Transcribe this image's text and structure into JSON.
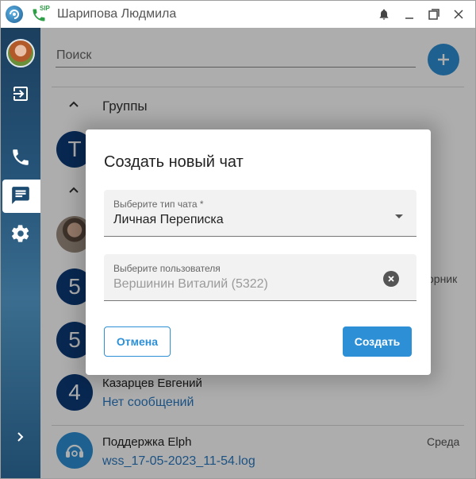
{
  "window": {
    "title": "Шарипова Людмила",
    "sip_label": "SIP"
  },
  "search": {
    "placeholder": "Поиск"
  },
  "groups": {
    "title": "Группы"
  },
  "list": {
    "avatars": [
      "T",
      "5",
      "5",
      "4"
    ],
    "hint_text": "орник",
    "item_kazartsev": {
      "name": "Казарцев Евгений",
      "sub": "Нет сообщений"
    },
    "item_support": {
      "name": "Поддержка Elph",
      "sub": "wss_17-05-2023_11-54.log",
      "time": "Среда"
    }
  },
  "dialog": {
    "title": "Создать новый чат",
    "chat_type": {
      "label": "Выберите тип чата *",
      "value": "Личная Переписка"
    },
    "user": {
      "label": "Выберите пользователя",
      "value": "Вершинин Виталий (5322)"
    },
    "cancel_label": "Отмена",
    "create_label": "Создать"
  },
  "colors": {
    "accent": "#2d8fd5",
    "avatar_dark": "#0d3b7a",
    "link": "#2a7ac2",
    "sidebar": "#26557a"
  }
}
